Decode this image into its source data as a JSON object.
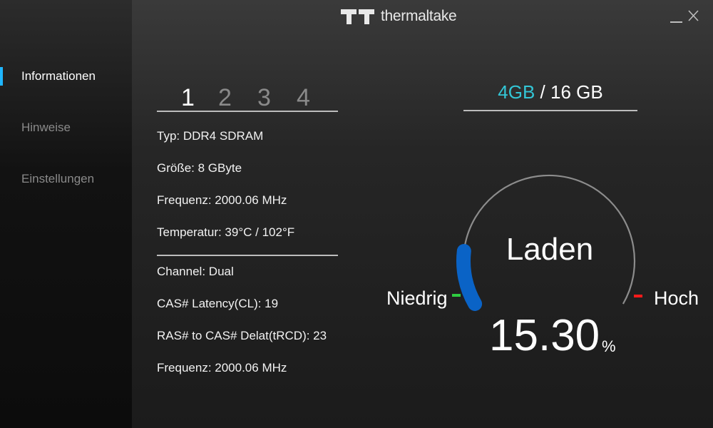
{
  "app": {
    "brand": "thermaltake",
    "window_controls": {
      "minimize": "minimize",
      "close": "close"
    }
  },
  "sidebar": {
    "items": [
      {
        "label": "Informationen",
        "active": true
      },
      {
        "label": "Hinweise",
        "active": false
      },
      {
        "label": "Einstellungen",
        "active": false
      }
    ]
  },
  "module_tabs": [
    "1",
    "2",
    "3",
    "4"
  ],
  "specs": {
    "type": "Typ: DDR4 SDRAM",
    "size": "Größe: 8 GByte",
    "frequency": "Frequenz: 2000.06 MHz",
    "temperature": "Temperatur: 39°C / 102°F",
    "channel_label": "Channel:",
    "channel_value": "Dual",
    "cas_latency": "CAS# Latency(CL): 19",
    "ras_to_cas": "RAS# to CAS# Delat(tRCD): 23",
    "frequency2": "Frequenz: 2000.06 MHz"
  },
  "memory": {
    "used": "4GB",
    "separator": " / ",
    "total": "16 GB"
  },
  "gauge": {
    "title": "Laden",
    "low_label": "Niedrig",
    "high_label": "Hoch",
    "value": "15.30",
    "unit": "%",
    "level_percent": 15.3,
    "colors": {
      "fill": "#0a63c6",
      "track": "#8c8c8c",
      "low_marker": "#2ecc40",
      "high_marker": "#ff1a1a"
    }
  },
  "colors": {
    "accent": "#1fb6ff",
    "capacity_used": "#33c6d6"
  }
}
